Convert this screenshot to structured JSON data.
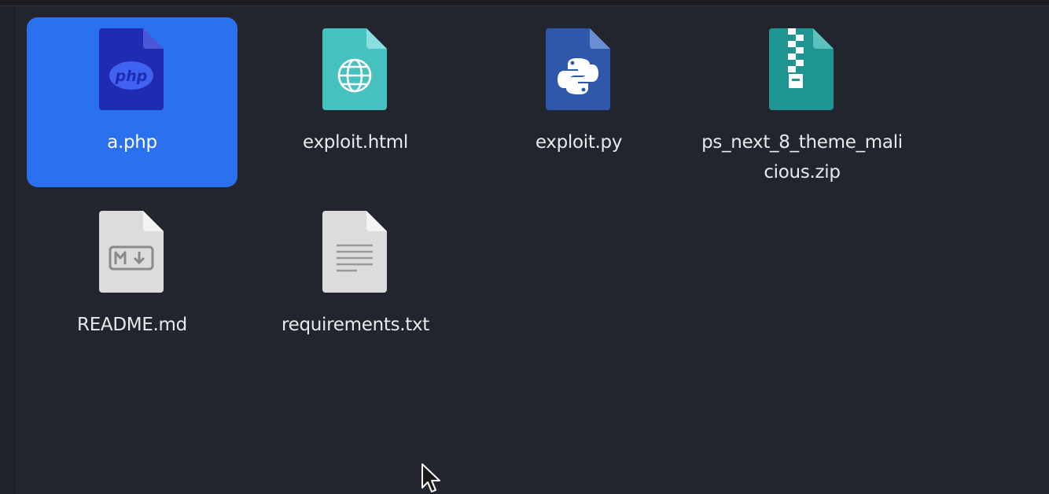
{
  "files": [
    {
      "name": "a.php",
      "icon": "php-file-icon",
      "selected": true,
      "color": "#1e2ab0"
    },
    {
      "name": "exploit.html",
      "icon": "html-file-icon",
      "selected": false,
      "color": "#44bfbe"
    },
    {
      "name": "exploit.py",
      "icon": "python-file-icon",
      "selected": false,
      "color": "#2f57a8"
    },
    {
      "name": "ps_next_8_theme_malicious.zip",
      "icon": "zip-file-icon",
      "selected": false,
      "color": "#1f9491"
    },
    {
      "name": "README.md",
      "icon": "markdown-file-icon",
      "selected": false,
      "color": "#dddddd"
    },
    {
      "name": "requirements.txt",
      "icon": "text-file-icon",
      "selected": false,
      "color": "#dddddd"
    }
  ],
  "colors": {
    "background": "#23252e",
    "selection": "#2a71f0",
    "text": "#e8e9ec"
  }
}
